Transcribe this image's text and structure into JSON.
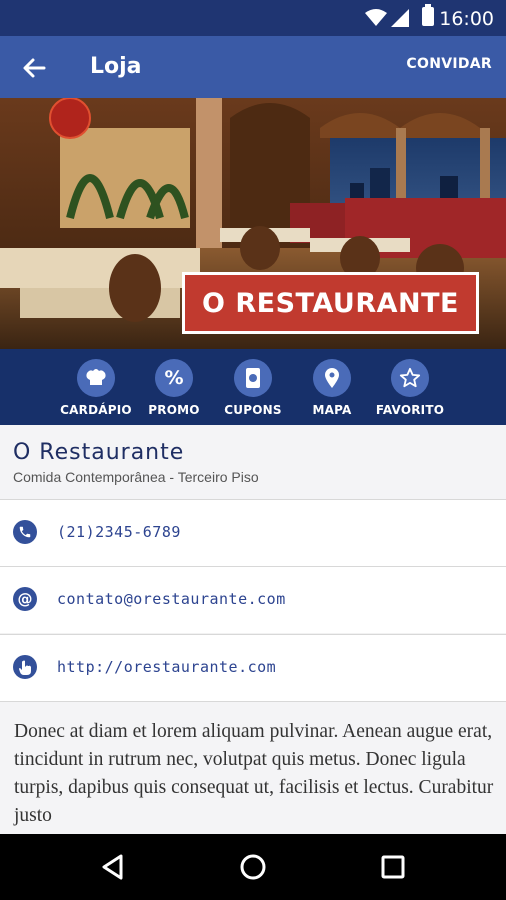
{
  "status_bar": {
    "time": "16:00"
  },
  "app_bar": {
    "title": "Loja",
    "invite_label": "CONVIDAR"
  },
  "hero": {
    "badge_text": "O RESTAURANTE"
  },
  "actions": [
    {
      "label": "CARDÁPIO",
      "icon": "chef-hat-icon"
    },
    {
      "label": "PROMO",
      "icon": "percent-icon"
    },
    {
      "label": "CUPONS",
      "icon": "coupon-icon"
    },
    {
      "label": "MAPA",
      "icon": "map-pin-icon"
    },
    {
      "label": "FAVORITO",
      "icon": "star-icon"
    }
  ],
  "store": {
    "name": "O Restaurante",
    "subtitle": "Comida Contemporânea - Terceiro Piso"
  },
  "contacts": {
    "phone": "(21)2345-6789",
    "email": "contato@orestaurante.com",
    "website": "http://orestaurante.com"
  },
  "description": "Donec at diam et lorem aliquam pulvinar. Aenean augue erat, tincidunt in rutrum nec, volutpat quis metus. Donec ligula turpis, dapibus quis consequat ut, facilisis et lectus. Curabitur justo",
  "colors": {
    "primary": "#3a5aa6",
    "dark": "#17306a",
    "status": "#1f3572",
    "badge": "#c13a2f"
  }
}
